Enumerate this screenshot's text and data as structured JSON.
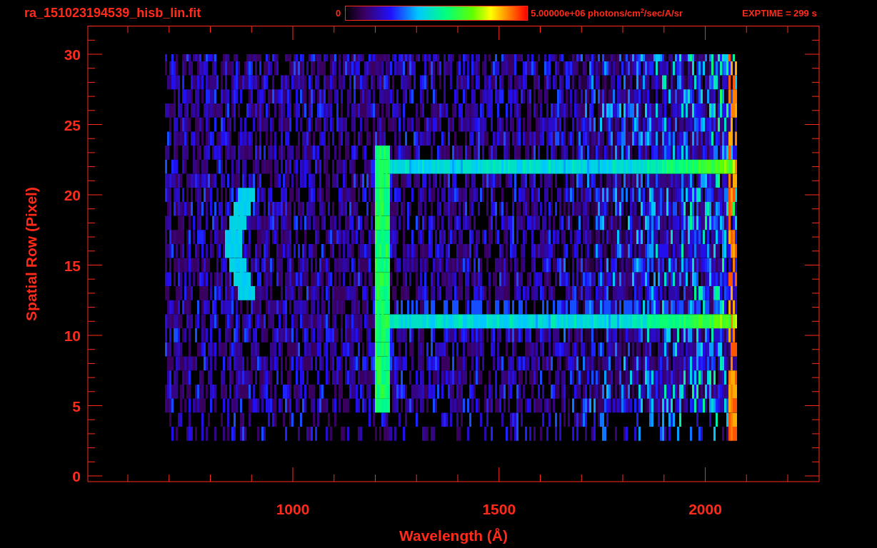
{
  "header": {
    "title": "ra_151023194539_hisb_lin.fit",
    "colorbar": {
      "min_label": "0",
      "max_label": "5.00000e+06 photons/cm$^{2}$/sec/A/sr"
    },
    "exposure": "EXPTIME = 299 s"
  },
  "plot": {
    "xlabel": "Wavelength (Å)",
    "ylabel": "Spatial Row (Pixel)",
    "xtick_labels": [
      "1000",
      "1500",
      "2000"
    ],
    "ytick_labels": [
      "30",
      "25",
      "20",
      "15",
      "10",
      "5",
      "0"
    ]
  }
}
